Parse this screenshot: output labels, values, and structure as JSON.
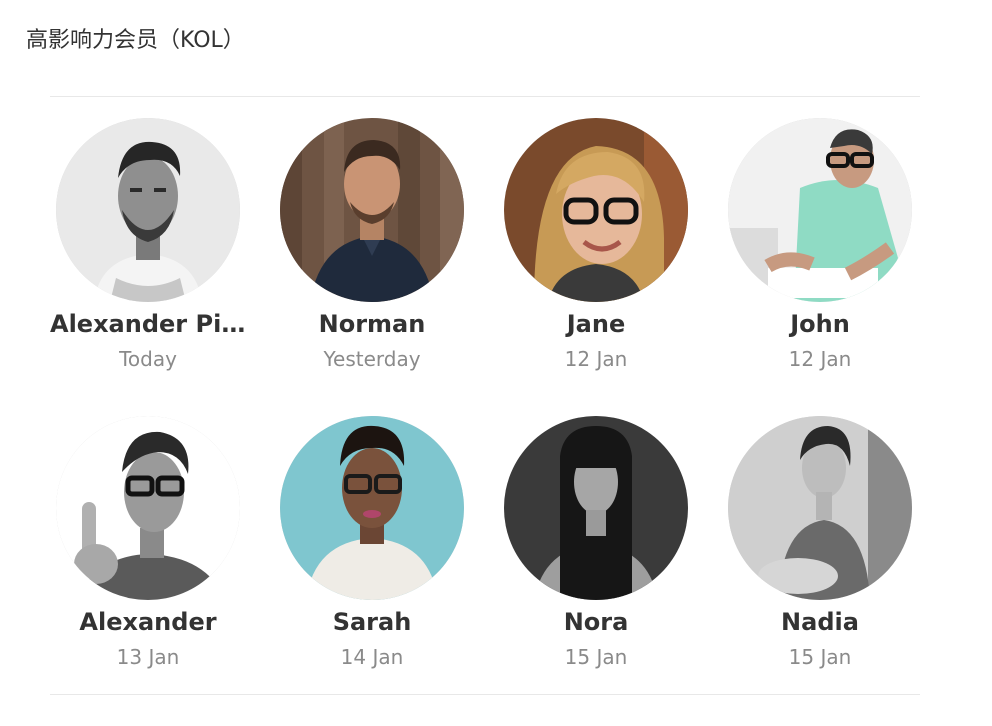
{
  "section": {
    "title": "高影响力会员（KOL）"
  },
  "members": [
    {
      "name": "Alexander Pierce",
      "date": "Today",
      "photo": "bearded man, grayscale, light background"
    },
    {
      "name": "Norman",
      "date": "Yesterday",
      "photo": "man in dark shirt, wooden wall"
    },
    {
      "name": "Jane",
      "date": "12 Jan",
      "photo": "woman with glasses, blonde hair"
    },
    {
      "name": "John",
      "date": "12 Jan",
      "photo": "man with glasses, mint shirt, drawing"
    },
    {
      "name": "Alexander",
      "date": "13 Jan",
      "photo": "man with glasses, finger raised, grayscale"
    },
    {
      "name": "Sarah",
      "date": "14 Jan",
      "photo": "woman with glasses, teal background"
    },
    {
      "name": "Nora",
      "date": "15 Jan",
      "photo": "woman with long dark hair, grayscale"
    },
    {
      "name": "Nadia",
      "date": "15 Jan",
      "photo": "woman seated, grayscale"
    }
  ],
  "colors": {
    "text": "#333333",
    "muted": "#8a8a8a",
    "divider": "#e8e8e8"
  }
}
